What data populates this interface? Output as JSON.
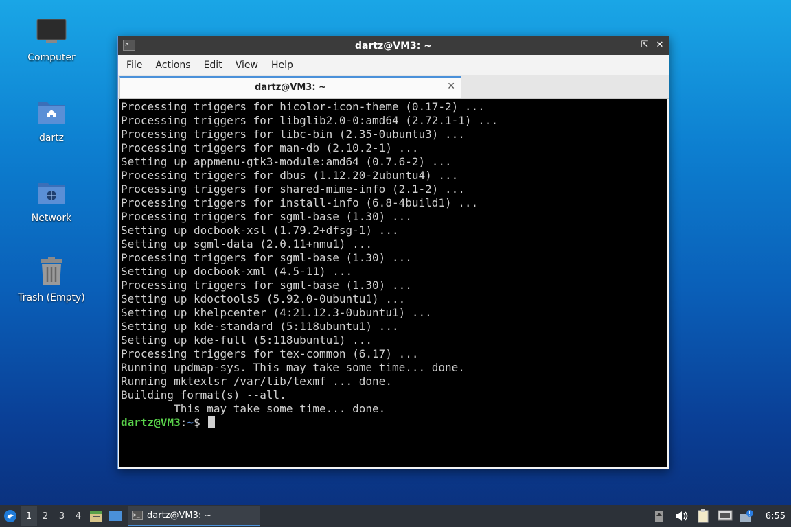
{
  "desktop": {
    "icons": [
      {
        "label": "Computer",
        "icon": "computer-icon"
      },
      {
        "label": "dartz",
        "icon": "home-folder-icon"
      },
      {
        "label": "Network",
        "icon": "network-folder-icon"
      },
      {
        "label": "Trash (Empty)",
        "icon": "trash-icon"
      }
    ]
  },
  "window": {
    "title": "dartz@VM3: ~",
    "menu": [
      "File",
      "Actions",
      "Edit",
      "View",
      "Help"
    ],
    "tab": {
      "title": "dartz@VM3: ~"
    },
    "terminal": {
      "lines": [
        "Processing triggers for hicolor-icon-theme (0.17-2) ...",
        "Processing triggers for libglib2.0-0:amd64 (2.72.1-1) ...",
        "Processing triggers for libc-bin (2.35-0ubuntu3) ...",
        "Processing triggers for man-db (2.10.2-1) ...",
        "Setting up appmenu-gtk3-module:amd64 (0.7.6-2) ...",
        "Processing triggers for dbus (1.12.20-2ubuntu4) ...",
        "Processing triggers for shared-mime-info (2.1-2) ...",
        "Processing triggers for install-info (6.8-4build1) ...",
        "Processing triggers for sgml-base (1.30) ...",
        "Setting up docbook-xsl (1.79.2+dfsg-1) ...",
        "Setting up sgml-data (2.0.11+nmu1) ...",
        "Processing triggers for sgml-base (1.30) ...",
        "Setting up docbook-xml (4.5-11) ...",
        "Processing triggers for sgml-base (1.30) ...",
        "Setting up kdoctools5 (5.92.0-0ubuntu1) ...",
        "Setting up khelpcenter (4:21.12.3-0ubuntu1) ...",
        "Setting up kde-standard (5:118ubuntu1) ...",
        "Setting up kde-full (5:118ubuntu1) ...",
        "Processing triggers for tex-common (6.17) ...",
        "Running updmap-sys. This may take some time... done.",
        "Running mktexlsr /var/lib/texmf ... done.",
        "Building format(s) --all.",
        "        This may take some time... done."
      ],
      "prompt": {
        "user": "dartz@VM3",
        "sep": ":",
        "path": "~",
        "symbol": "$ "
      }
    }
  },
  "taskbar": {
    "workspaces": [
      "1",
      "2",
      "3",
      "4"
    ],
    "active_workspace": "1",
    "task_label": "dartz@VM3: ~",
    "clock": "6:55"
  }
}
